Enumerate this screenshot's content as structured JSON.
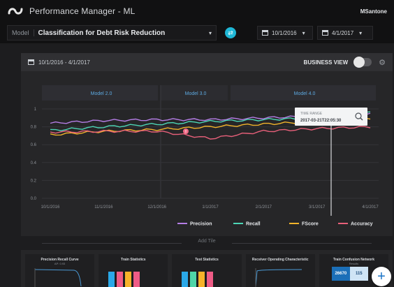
{
  "header": {
    "app_title": "Performance Manager - ML",
    "user": "MSantone"
  },
  "model_bar": {
    "label": "Model",
    "model_name": "Classification for Debt Risk Reduction",
    "start_date": "10/1/2016",
    "end_date": "4/1/2017"
  },
  "panel": {
    "date_range": "10/1/2016 - 4/1/2017",
    "business_view_label": "BUSINESS VIEW",
    "business_view_on": false,
    "model_versions": [
      "Model 2.0",
      "Model 3.0",
      "Model 4.0"
    ],
    "tooltip": {
      "title": "TIME RANGE",
      "value": "2017-03-21T22:05:30"
    },
    "annotation_marker": "!"
  },
  "chart_data": {
    "type": "line",
    "x": [
      "10/1/2016",
      "11/1/2016",
      "12/1/2016",
      "1/1/2017",
      "2/1/2017",
      "3/1/2017",
      "4/1/2017"
    ],
    "ylim": [
      0,
      1
    ],
    "yticks": [
      "0.0",
      "0.2",
      "0.4",
      "0.6",
      "0.8",
      "1"
    ],
    "grid": true,
    "legend_position": "bottom-right",
    "series": [
      {
        "name": "Precision",
        "color": "#b57ee6",
        "values": [
          0.84,
          0.87,
          0.88,
          0.88,
          0.9,
          0.92,
          0.94
        ]
      },
      {
        "name": "Recall",
        "color": "#4dd6b6",
        "values": [
          0.76,
          0.8,
          0.83,
          0.86,
          0.88,
          0.9,
          0.96
        ]
      },
      {
        "name": "FScore",
        "color": "#f2b42b",
        "values": [
          0.71,
          0.75,
          0.77,
          0.8,
          0.83,
          0.86,
          0.89
        ]
      },
      {
        "name": "Accuracy",
        "color": "#e8607a",
        "values": [
          0.74,
          0.75,
          0.75,
          0.67,
          0.75,
          0.78,
          0.8
        ]
      }
    ]
  },
  "add_tile_label": "Add Tile",
  "tiles": [
    {
      "title": "Precision Recall Curve",
      "subtitle": "AP: 0.93"
    },
    {
      "title": "Train Statistics",
      "subtitle": ""
    },
    {
      "title": "Test Statistics",
      "subtitle": ""
    },
    {
      "title": "Receiver Operating Characteristic",
      "subtitle": ""
    },
    {
      "title": "Train Confusion Network",
      "subtitle": "Results",
      "cells": [
        "26670",
        "115"
      ]
    }
  ],
  "fab_label": "+"
}
